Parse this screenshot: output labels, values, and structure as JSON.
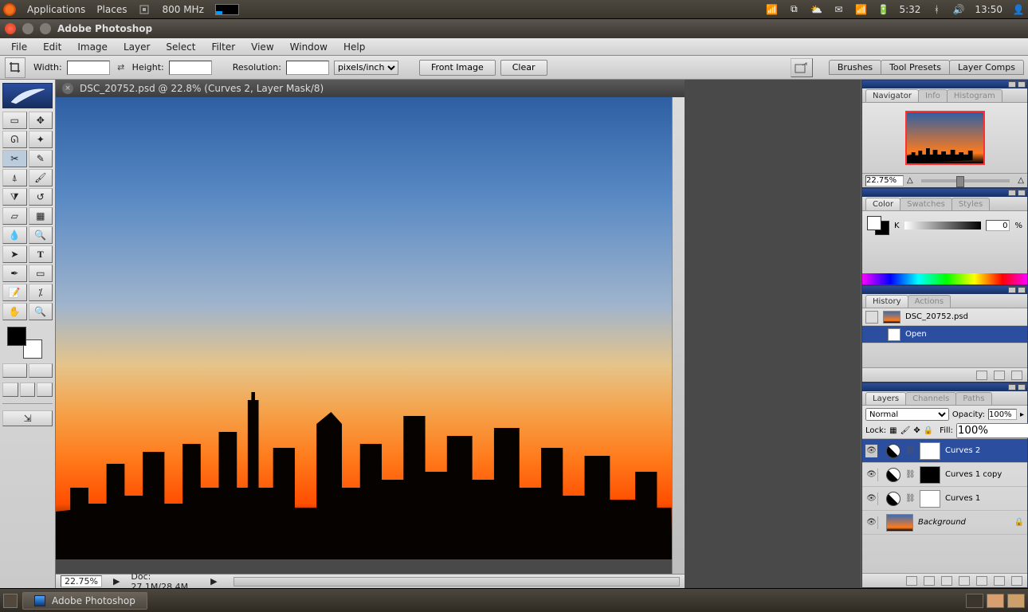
{
  "ubuntu": {
    "applications": "Applications",
    "places": "Places",
    "cpu": "800 MHz",
    "battery_time": "5:32",
    "clock": "13:50"
  },
  "app_title": "Adobe Photoshop",
  "menu": {
    "file": "File",
    "edit": "Edit",
    "image": "Image",
    "layer": "Layer",
    "select": "Select",
    "filter": "Filter",
    "view": "View",
    "window": "Window",
    "help": "Help"
  },
  "options": {
    "width_label": "Width:",
    "width_value": "",
    "height_label": "Height:",
    "height_value": "",
    "resolution_label": "Resolution:",
    "resolution_value": "",
    "resolution_unit": "pixels/inch",
    "front_image": "Front Image",
    "clear": "Clear",
    "right_tabs": {
      "brushes": "Brushes",
      "tool_presets": "Tool Presets",
      "layer_comps": "Layer Comps"
    }
  },
  "document": {
    "title": "DSC_20752.psd @ 22.8% (Curves 2, Layer Mask/8)",
    "zoom": "22.75%",
    "doc_size": "Doc: 27.1M/28.4M"
  },
  "navigator": {
    "tabs": {
      "navigator": "Navigator",
      "info": "Info",
      "histogram": "Histogram"
    },
    "zoom": "22.75%"
  },
  "color_panel": {
    "tabs": {
      "color": "Color",
      "swatches": "Swatches",
      "styles": "Styles"
    },
    "channel": "K",
    "value": "0",
    "pct": "%"
  },
  "history_panel": {
    "tabs": {
      "history": "History",
      "actions": "Actions"
    },
    "snapshot": "DSC_20752.psd",
    "step": "Open"
  },
  "layers_panel": {
    "tabs": {
      "layers": "Layers",
      "channels": "Channels",
      "paths": "Paths"
    },
    "blend": "Normal",
    "opacity_label": "Opacity:",
    "opacity": "100%",
    "lock_label": "Lock:",
    "fill_label": "Fill:",
    "fill": "100%",
    "layers": [
      {
        "name": "Curves 2"
      },
      {
        "name": "Curves 1 copy"
      },
      {
        "name": "Curves 1"
      },
      {
        "name": "Background"
      }
    ]
  },
  "taskbar": {
    "active": "Adobe Photoshop"
  }
}
